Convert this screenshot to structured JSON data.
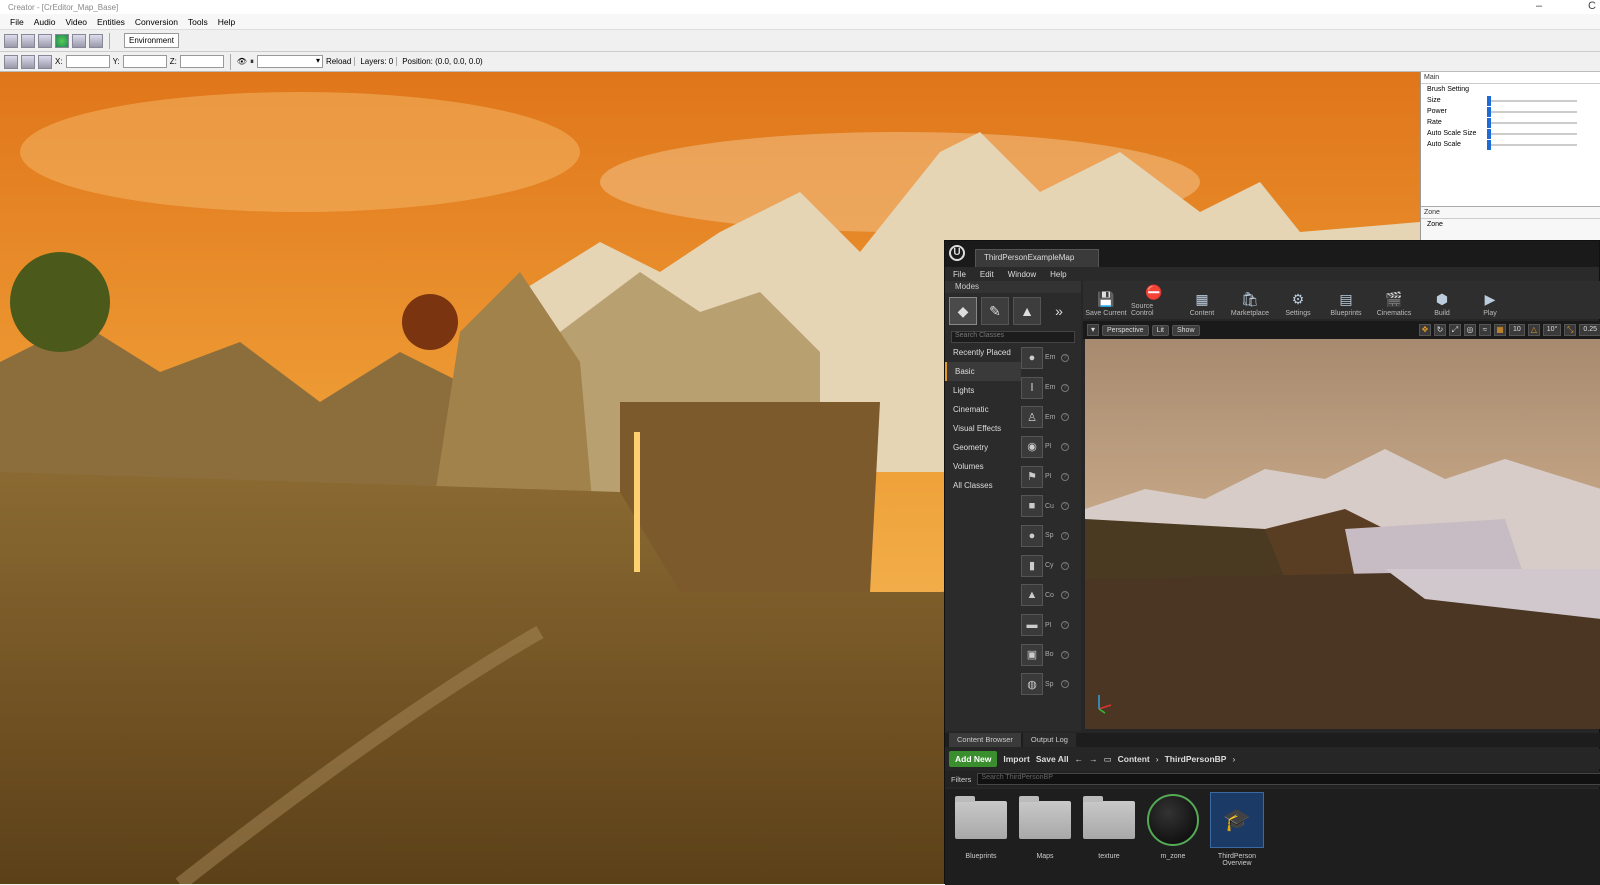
{
  "window": {
    "title": "Creator - [CrEditor_Map_Base]"
  },
  "menu": [
    "File",
    "Audio",
    "Video",
    "Entities",
    "Conversion",
    "Tools",
    "Help"
  ],
  "toolbar": {
    "environment_label": "Environment"
  },
  "toolbar2": {
    "x_label": "X:",
    "y_label": "Y:",
    "z_label": "Z:",
    "reload_label": "Reload",
    "layers_label": "Layers: 0",
    "position_label": "Position: (0.0, 0.0, 0.0)"
  },
  "right_panel": {
    "main_label": "Main",
    "brush_label": "Brush Setting",
    "sliders": [
      "Size",
      "Power",
      "Rate",
      "Auto Scale Size",
      "Auto Scale"
    ],
    "zone_header": "Zone",
    "zone_label": "Zone"
  },
  "ue": {
    "map_tab": "ThirdPersonExampleMap",
    "menu": [
      "File",
      "Edit",
      "Window",
      "Help"
    ],
    "modes_label": "Modes",
    "search_placeholder": "Search Classes",
    "categories": [
      "Recently Placed",
      "Basic",
      "Lights",
      "Cinematic",
      "Visual Effects",
      "Geometry",
      "Volumes",
      "All Classes"
    ],
    "items": [
      "Em",
      "Em",
      "Em",
      "Pl",
      "Pl",
      "Cu",
      "Sp",
      "Cy",
      "Co",
      "Pl",
      "Bo",
      "Sp"
    ],
    "toolbar": [
      "Save Current",
      "Source Control",
      "Content",
      "Marketplace",
      "Settings",
      "Blueprints",
      "Cinematics",
      "Build",
      "Play"
    ],
    "viewport": {
      "perspective": "Perspective",
      "lit": "Lit",
      "show": "Show",
      "grid": "10",
      "rot": "10°",
      "scale": "0.25"
    },
    "cb_tabs": [
      "Content Browser",
      "Output Log"
    ],
    "add_new": "Add New",
    "import": "Import",
    "save_all": "Save All",
    "path": [
      "Content",
      "ThirdPersonBP"
    ],
    "filters": "Filters",
    "cb_search_placeholder": "Search ThirdPersonBP",
    "assets": [
      "Blueprints",
      "Maps",
      "texture",
      "m_zone",
      "ThirdPerson Overview"
    ]
  }
}
